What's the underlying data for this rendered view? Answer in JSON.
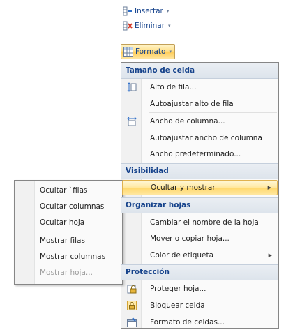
{
  "ribbon": {
    "insert_label": "Insertar",
    "delete_label": "Eliminar",
    "format_label": "Formato",
    "arrow": "▾"
  },
  "menu": {
    "section_cell_size": "Tamaño de celda",
    "row_height": "Alto de fila...",
    "autofit_row_height": "Autoajustar alto de fila",
    "column_width": "Ancho de columna...",
    "autofit_column_width": "Autoajustar ancho de columna",
    "default_width": "Ancho predeterminado...",
    "section_visibility": "Visibilidad",
    "hide_and_unhide": "Ocultar y mostrar",
    "section_organize_sheets": "Organizar hojas",
    "rename_sheet": "Cambiar el nombre de la hoja",
    "move_or_copy_sheet": "Mover o copiar hoja...",
    "tab_color": "Color de etiqueta",
    "section_protection": "Protección",
    "protect_sheet": "Proteger hoja...",
    "lock_cell": "Bloquear celda",
    "format_cells": "Formato de celdas...",
    "submenu_arrow": "▶"
  },
  "submenu": {
    "hide_rows": "Ocultar `filas",
    "hide_columns": "Ocultar columnas",
    "hide_sheet": "Ocultar hoja",
    "unhide_rows": "Mostrar filas",
    "unhide_columns": "Mostrar columnas",
    "unhide_sheet": "Mostrar hoja..."
  },
  "colors": {
    "header_text": "#15428b",
    "highlight": "#ffd86b",
    "disabled_text": "#9d9d9d"
  }
}
